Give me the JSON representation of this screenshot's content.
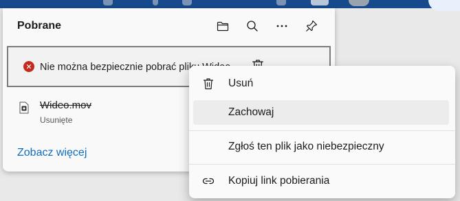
{
  "panel": {
    "title": "Pobrane",
    "toolbar": [
      {
        "name": "open-folder-button",
        "icon": "folder-icon"
      },
      {
        "name": "search-button",
        "icon": "search-icon"
      },
      {
        "name": "more-options-button",
        "icon": "more-icon"
      },
      {
        "name": "pin-button",
        "icon": "pin-icon"
      }
    ],
    "download_item": {
      "status_icon": "error-icon",
      "message": "Nie można bezpiecznie pobrać pliku Wideo"
    },
    "file": {
      "name": "Wideo.mov",
      "status": "Usunięte"
    },
    "see_more": "Zobacz więcej"
  },
  "menu": {
    "items": [
      {
        "label": "Usuń",
        "icon": "trash-icon"
      },
      {
        "label": "Zachowaj",
        "icon": ""
      },
      {
        "label": "Zgłoś ten plik jako niebezpieczny",
        "icon": ""
      },
      {
        "label": "Kopiuj link pobierania",
        "icon": "link-icon"
      }
    ]
  },
  "colors": {
    "accent": "#0f6cbd",
    "error": "#c42b1c",
    "titlebar": "#174a8c"
  }
}
